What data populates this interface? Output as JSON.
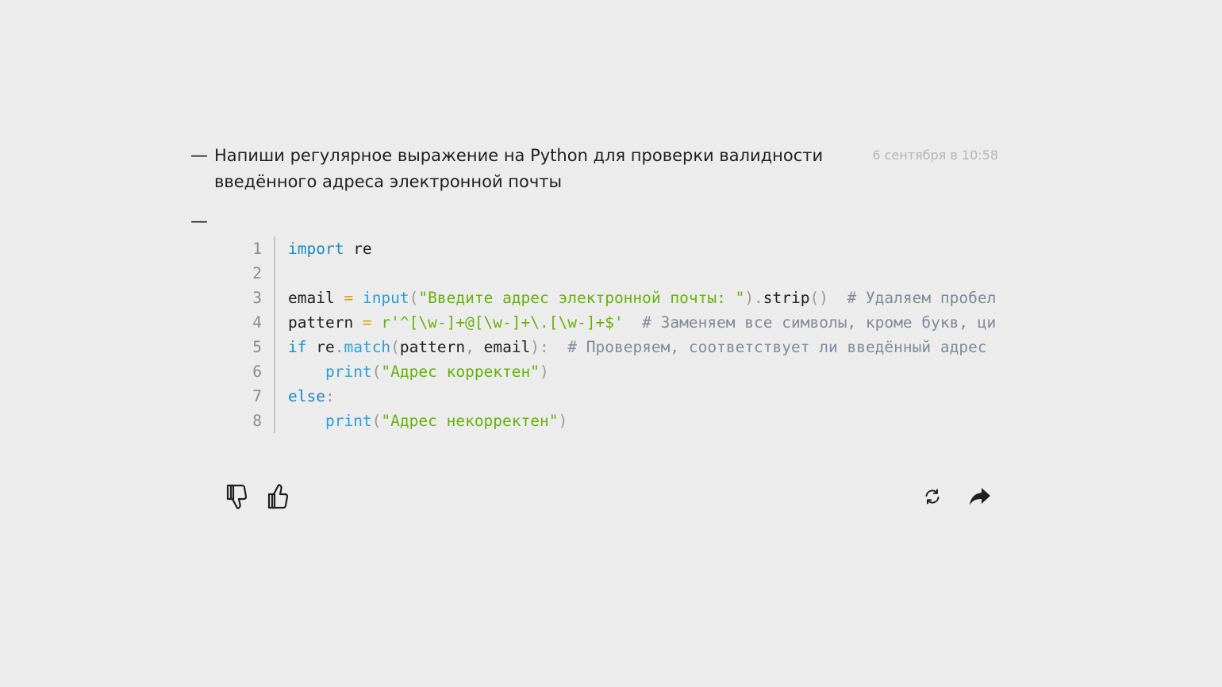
{
  "user_message": {
    "prefix": "—",
    "text": "Напиши регулярное выражение на Python для проверки валидности введённого адреса электронной почты",
    "timestamp": "6 сентября в 10:58"
  },
  "answer": {
    "prefix": "—",
    "code": {
      "line_numbers": [
        "1",
        "2",
        "3",
        "4",
        "5",
        "6",
        "7",
        "8"
      ],
      "lines": [
        [
          {
            "t": "import",
            "c": "kw"
          },
          {
            "t": " re",
            "c": "id"
          }
        ],
        [
          {
            "t": "",
            "c": "id"
          }
        ],
        [
          {
            "t": "email ",
            "c": "id"
          },
          {
            "t": "=",
            "c": "op"
          },
          {
            "t": " ",
            "c": "id"
          },
          {
            "t": "input",
            "c": "fn"
          },
          {
            "t": "(",
            "c": "punc"
          },
          {
            "t": "\"Введите адрес электронной почты: \"",
            "c": "str"
          },
          {
            "t": ").",
            "c": "punc"
          },
          {
            "t": "strip",
            "c": "id"
          },
          {
            "t": "()",
            "c": "punc"
          },
          {
            "t": "  # Удаляем пробел",
            "c": "cmt"
          }
        ],
        [
          {
            "t": "pattern ",
            "c": "id"
          },
          {
            "t": "=",
            "c": "op"
          },
          {
            "t": " ",
            "c": "id"
          },
          {
            "t": "r'^[\\w-]+@[\\w-]+\\.[\\w-]+$'",
            "c": "str"
          },
          {
            "t": "  # Заменяем все символы, кроме букв, ци",
            "c": "cmt"
          }
        ],
        [
          {
            "t": "if",
            "c": "kw"
          },
          {
            "t": " re",
            "c": "id"
          },
          {
            "t": ".",
            "c": "punc"
          },
          {
            "t": "match",
            "c": "fn"
          },
          {
            "t": "(",
            "c": "punc"
          },
          {
            "t": "pattern",
            "c": "id"
          },
          {
            "t": ", ",
            "c": "punc"
          },
          {
            "t": "email",
            "c": "id"
          },
          {
            "t": "):",
            "c": "punc"
          },
          {
            "t": "  # Проверяем, соответствует ли введённый адрес",
            "c": "cmt"
          }
        ],
        [
          {
            "t": "    ",
            "c": "id"
          },
          {
            "t": "print",
            "c": "fn"
          },
          {
            "t": "(",
            "c": "punc"
          },
          {
            "t": "\"Адрес корректен\"",
            "c": "str"
          },
          {
            "t": ")",
            "c": "punc"
          }
        ],
        [
          {
            "t": "else",
            "c": "kw"
          },
          {
            "t": ":",
            "c": "punc"
          }
        ],
        [
          {
            "t": "    ",
            "c": "id"
          },
          {
            "t": "print",
            "c": "fn"
          },
          {
            "t": "(",
            "c": "punc"
          },
          {
            "t": "\"Адрес некорректен\"",
            "c": "str"
          },
          {
            "t": ")",
            "c": "punc"
          }
        ]
      ]
    }
  },
  "actions": {
    "dislike": {
      "icon": "thumbs-down-icon"
    },
    "like": {
      "icon": "thumbs-up-icon"
    },
    "regenerate": {
      "icon": "refresh-icon"
    },
    "share": {
      "icon": "share-arrow-icon"
    }
  },
  "colors": {
    "background": "#ececec",
    "keyword": "#1b8bbf",
    "string": "#67b20a",
    "operator": "#e0a000",
    "comment": "#7f8b9a",
    "timestamp": "#b5b5b5"
  }
}
